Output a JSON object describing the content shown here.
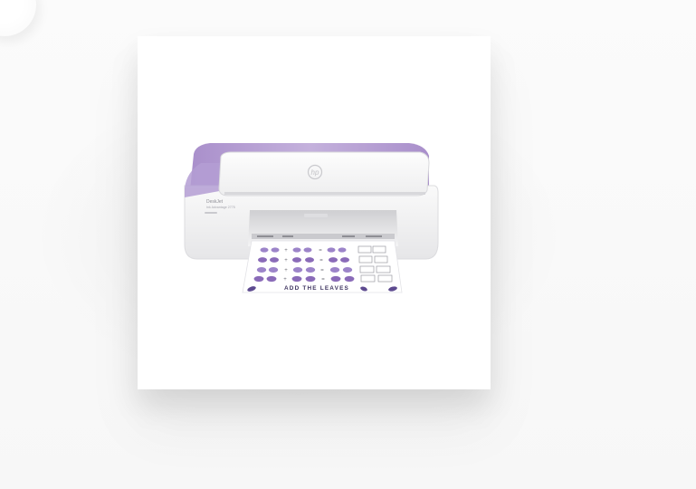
{
  "product": {
    "image_alt": "HP DeskJet all-in-one printer with lilac lid",
    "brand_logo_text": "hp",
    "model_label": "DeskJet",
    "model_sublabel": "Ink Advantage 2775",
    "sheet_caption": "ADD THE LEAVES"
  },
  "colors": {
    "lilac": "#b9a3d3",
    "lilac_dark": "#9e86bc",
    "body_white": "#f2f2f3",
    "paper": "#ffffff",
    "leaf_purple": "#8a6bb8"
  }
}
